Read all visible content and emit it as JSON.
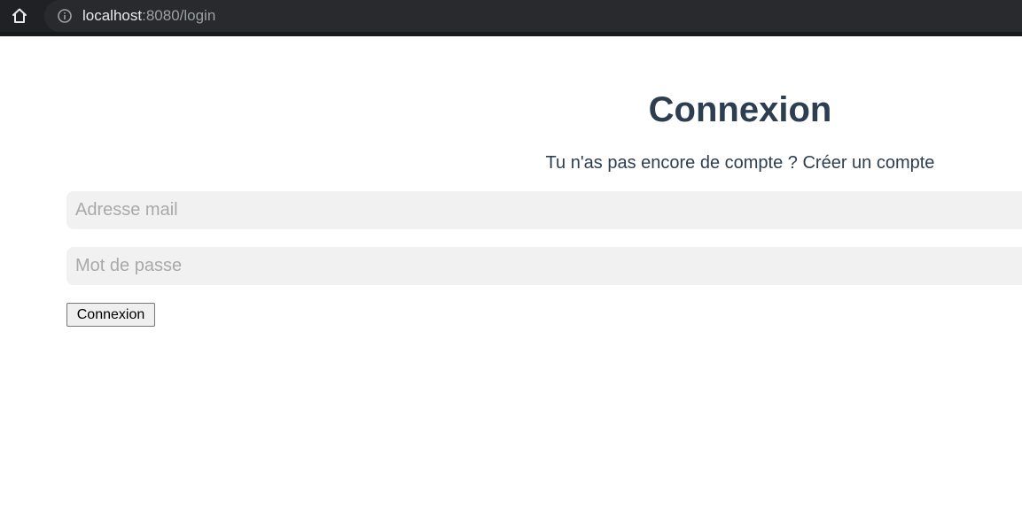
{
  "browser": {
    "url_host": "localhost",
    "url_rest": ":8080/login"
  },
  "page": {
    "title": "Connexion",
    "signup_prompt": "Tu n'as pas encore de compte ? ",
    "signup_link": "Créer un compte"
  },
  "form": {
    "email_placeholder": "Adresse mail",
    "email_value": "",
    "password_placeholder": "Mot de passe",
    "password_value": "",
    "submit_label": "Connexion"
  },
  "colors": {
    "heading": "#2c3e50",
    "input_bg": "#f1f1f1",
    "browser_bar": "#202124"
  }
}
